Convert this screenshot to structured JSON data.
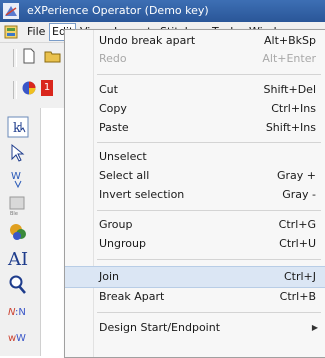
{
  "window": {
    "title": "eXPerience Operator (Demo key)"
  },
  "menubar": {
    "items": [
      {
        "label": "File"
      },
      {
        "label": "Edit"
      },
      {
        "label": "View"
      },
      {
        "label": "Layout"
      },
      {
        "label": "Stitches"
      },
      {
        "label": "Tools"
      },
      {
        "label": "Windo"
      }
    ]
  },
  "toolbar": {
    "badge": "1"
  },
  "edit_menu": {
    "items": [
      {
        "label": "Undo break apart",
        "shortcut": "Alt+BkSp"
      },
      {
        "label": "Redo",
        "shortcut": "Alt+Enter",
        "disabled": true
      },
      {
        "label": "Cut",
        "shortcut": "Shift+Del"
      },
      {
        "label": "Copy",
        "shortcut": "Ctrl+Ins"
      },
      {
        "label": "Paste",
        "shortcut": "Shift+Ins"
      },
      {
        "label": "Unselect",
        "shortcut": ""
      },
      {
        "label": "Select all",
        "shortcut": "Gray +"
      },
      {
        "label": "Invert selection",
        "shortcut": "Gray -"
      },
      {
        "label": "Group",
        "shortcut": "Ctrl+G"
      },
      {
        "label": "Ungroup",
        "shortcut": "Ctrl+U"
      },
      {
        "label": "Join",
        "shortcut": "Ctrl+J",
        "highlighted": true
      },
      {
        "label": "Break Apart",
        "shortcut": "Ctrl+B"
      },
      {
        "label": "Design Start/Endpoint",
        "shortcut": "",
        "submenu": true
      }
    ]
  },
  "colors": {
    "titlebar": "#2f5fa4",
    "menu_highlight": "#dbe6f4",
    "accent_red": "#d9261c"
  }
}
